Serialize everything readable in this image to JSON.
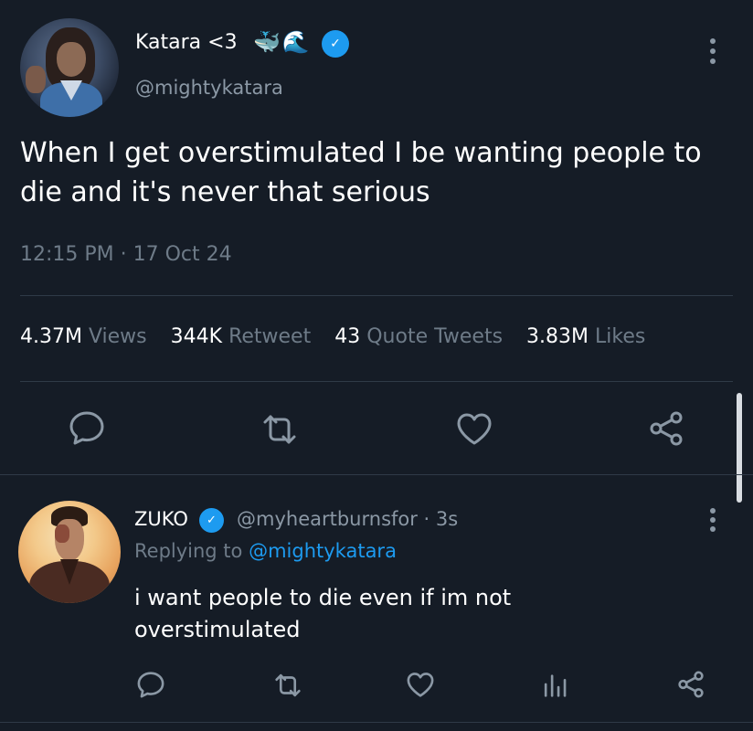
{
  "tweet": {
    "author_name": "Katara <3",
    "author_emojis": "🐳🌊",
    "handle": "@mightykatara",
    "text": "When I get overstimulated I be wanting people to die and it's never that serious",
    "timestamp": "12:15 PM · 17 Oct 24",
    "stats": {
      "views_count": "4.37M",
      "views_label": "Views",
      "retweets_count": "344K",
      "retweets_label": "Retweet",
      "quotes_count": "43",
      "quotes_label": "Quote Tweets",
      "likes_count": "3.83M",
      "likes_label": "Likes"
    },
    "verified_mark": "✓"
  },
  "reply": {
    "author_name": "ZUKO",
    "handle_time": "@myheartburnsfor · 3s",
    "replying_prefix": "Replying to ",
    "replying_mention": "@mightykatara",
    "text": "i want people to die even if im not overstimulated",
    "verified_mark": "✓"
  },
  "icons": {
    "reply": "reply-icon",
    "retweet": "retweet-icon",
    "like": "heart-icon",
    "share": "share-icon",
    "analytics": "analytics-icon",
    "more": "more-vertical-icon"
  },
  "colors": {
    "background": "#151c26",
    "accent": "#1d9bf0",
    "muted": "#6e7b88",
    "divider": "#2f3a47"
  }
}
